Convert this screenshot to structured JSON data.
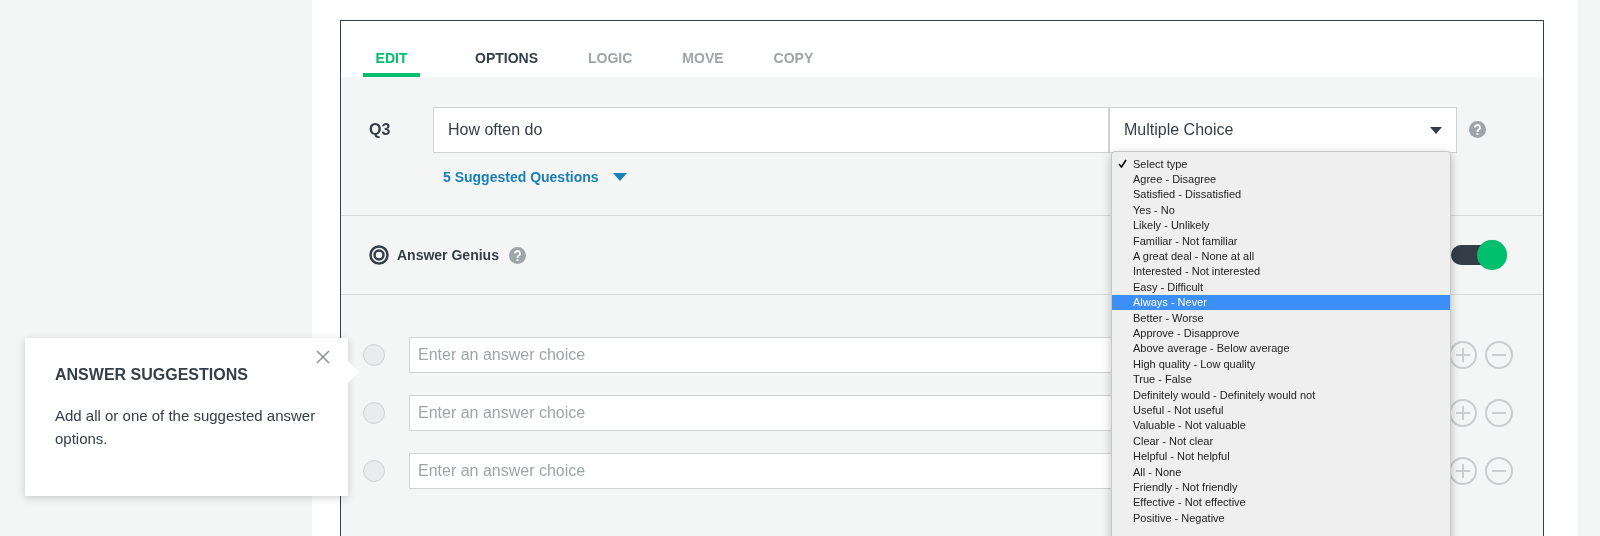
{
  "tabs": [
    {
      "label": "EDIT",
      "selected": true
    },
    {
      "label": "OPTIONS",
      "selected": false,
      "disabled": false
    },
    {
      "label": "LOGIC",
      "selected": false,
      "disabled": true
    },
    {
      "label": "MOVE",
      "selected": false,
      "disabled": true
    },
    {
      "label": "COPY",
      "selected": false,
      "disabled": true
    }
  ],
  "question": {
    "number": "Q3",
    "value": "How often do",
    "type": "Multiple Choice",
    "suggested": "5 Suggested Questions"
  },
  "answer_genius": {
    "label": "Answer Genius",
    "on": true
  },
  "type_menu": {
    "items": [
      {
        "label": "Select type",
        "checked": true,
        "selected": false
      },
      {
        "label": "Agree - Disagree",
        "checked": false,
        "selected": false
      },
      {
        "label": "Satisfied - Dissatisfied",
        "checked": false,
        "selected": false
      },
      {
        "label": "Yes - No",
        "checked": false,
        "selected": false
      },
      {
        "label": "Likely - Unlikely",
        "checked": false,
        "selected": false
      },
      {
        "label": "Familiar - Not familiar",
        "checked": false,
        "selected": false
      },
      {
        "label": "A great deal - None at all",
        "checked": false,
        "selected": false
      },
      {
        "label": "Interested - Not interested",
        "checked": false,
        "selected": false
      },
      {
        "label": "Easy - Difficult",
        "checked": false,
        "selected": false
      },
      {
        "label": "Always - Never",
        "checked": false,
        "selected": true
      },
      {
        "label": "Better - Worse",
        "checked": false,
        "selected": false
      },
      {
        "label": "Approve - Disapprove",
        "checked": false,
        "selected": false
      },
      {
        "label": "Above average - Below average",
        "checked": false,
        "selected": false
      },
      {
        "label": "High quality - Low quality",
        "checked": false,
        "selected": false
      },
      {
        "label": "True - False",
        "checked": false,
        "selected": false
      },
      {
        "label": "Definitely would - Definitely would not",
        "checked": false,
        "selected": false
      },
      {
        "label": "Useful - Not useful",
        "checked": false,
        "selected": false
      },
      {
        "label": "Valuable - Not valuable",
        "checked": false,
        "selected": false
      },
      {
        "label": "Clear - Not clear",
        "checked": false,
        "selected": false
      },
      {
        "label": "Helpful - Not helpful",
        "checked": false,
        "selected": false
      },
      {
        "label": "All - None",
        "checked": false,
        "selected": false
      },
      {
        "label": "Friendly - Not friendly",
        "checked": false,
        "selected": false
      },
      {
        "label": "Effective - Not effective",
        "checked": false,
        "selected": false
      },
      {
        "label": "Positive - Negative",
        "checked": false,
        "selected": false
      }
    ]
  },
  "answers": [
    {
      "placeholder": "Enter an answer choice",
      "selected": false
    },
    {
      "placeholder": "Enter an answer choice",
      "selected": false
    },
    {
      "placeholder": "Enter an answer choice",
      "selected": false
    }
  ],
  "tooltip": {
    "title": "ANSWER SUGGESTIONS",
    "text": "Add all or one of the suggested answer options."
  }
}
